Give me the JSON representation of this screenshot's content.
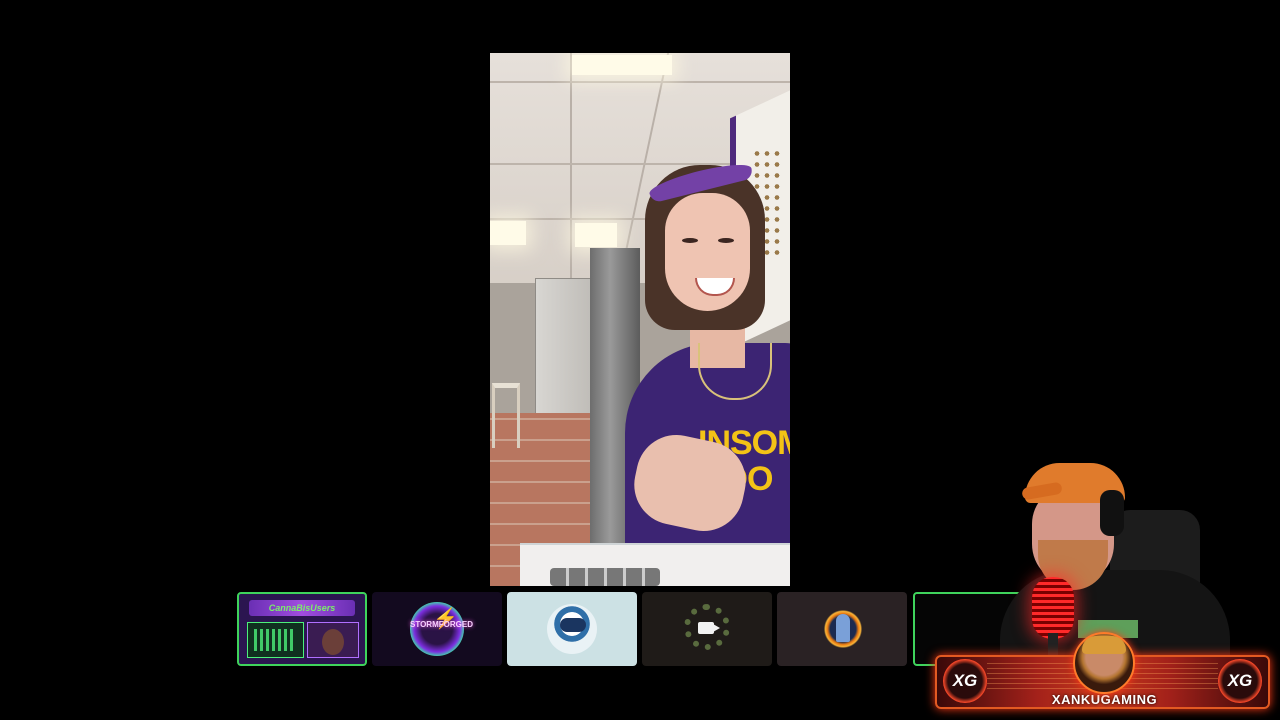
{
  "main_video": {
    "participant": "main-participant",
    "shirt_text_line1": "INSOM",
    "shirt_text_line2": "COO"
  },
  "participants": [
    {
      "id": "tile-1",
      "active_border": true,
      "label": "CannaBisUsers",
      "color": "#3fd35c"
    },
    {
      "id": "tile-2",
      "active_border": false,
      "label": "STORMFORGED",
      "color": "#7c2ee0"
    },
    {
      "id": "tile-3",
      "active_border": false,
      "label": "",
      "color": "#cce1e4"
    },
    {
      "id": "tile-4",
      "active_border": false,
      "label": "",
      "icon": "video-camera-icon"
    },
    {
      "id": "tile-5",
      "active_border": false,
      "label": "",
      "color": "#e97b12"
    },
    {
      "id": "tile-6",
      "active_border": true,
      "label": "",
      "color": "#3fd35c"
    }
  ],
  "streamer": {
    "name": "XANKUGAMING",
    "badge_left": "XG",
    "badge_right": "XG",
    "accent_color": "#e35a22"
  }
}
